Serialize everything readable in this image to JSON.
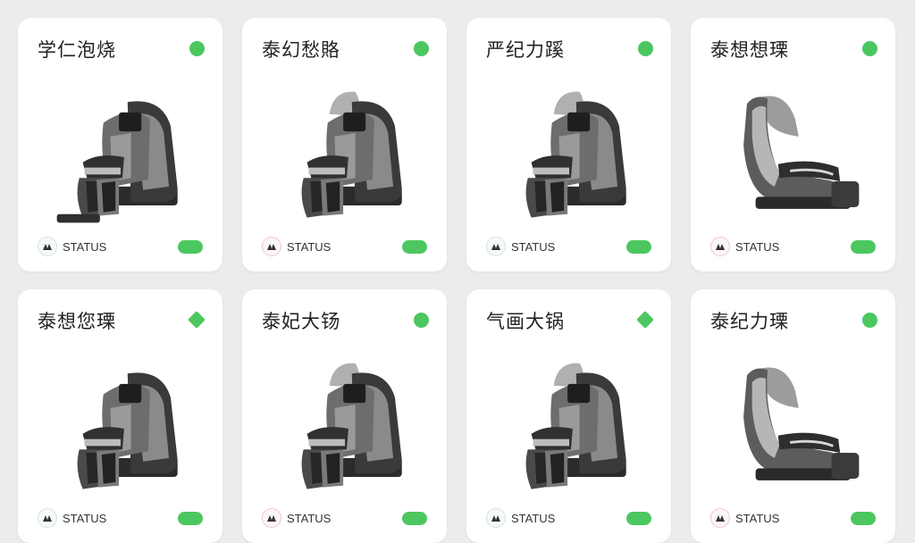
{
  "accent_color": "#4cc760",
  "cards": [
    {
      "title": "学仁泡烧",
      "status_label": "STATUS",
      "indicator": "dot",
      "status_icon": "link-icon",
      "chair": "full-footrest"
    },
    {
      "title": "泰幻愁賂",
      "status_label": "STATUS",
      "indicator": "dot",
      "status_icon": "link-icon",
      "chair": "headrest-raised"
    },
    {
      "title": "严纪力蹊",
      "status_label": "STATUS",
      "indicator": "dot",
      "status_icon": "link-icon",
      "chair": "headrest-raised"
    },
    {
      "title": "泰想想瑮",
      "status_label": "STATUS",
      "indicator": "dot",
      "status_icon": "link-icon",
      "chair": "side-profile"
    },
    {
      "title": "泰想您瑮",
      "status_label": "STATUS",
      "indicator": "diamond",
      "status_icon": "link-icon",
      "chair": "full"
    },
    {
      "title": "泰妃大钖",
      "status_label": "STATUS",
      "indicator": "dot",
      "status_icon": "link-icon",
      "chair": "headrest-raised"
    },
    {
      "title": "气画大锅",
      "status_label": "STATUS",
      "indicator": "diamond",
      "status_icon": "link-icon",
      "chair": "headrest-raised"
    },
    {
      "title": "泰纪力瑮",
      "status_label": "STATUS",
      "indicator": "dot",
      "status_icon": "link-icon",
      "chair": "side-profile"
    }
  ]
}
